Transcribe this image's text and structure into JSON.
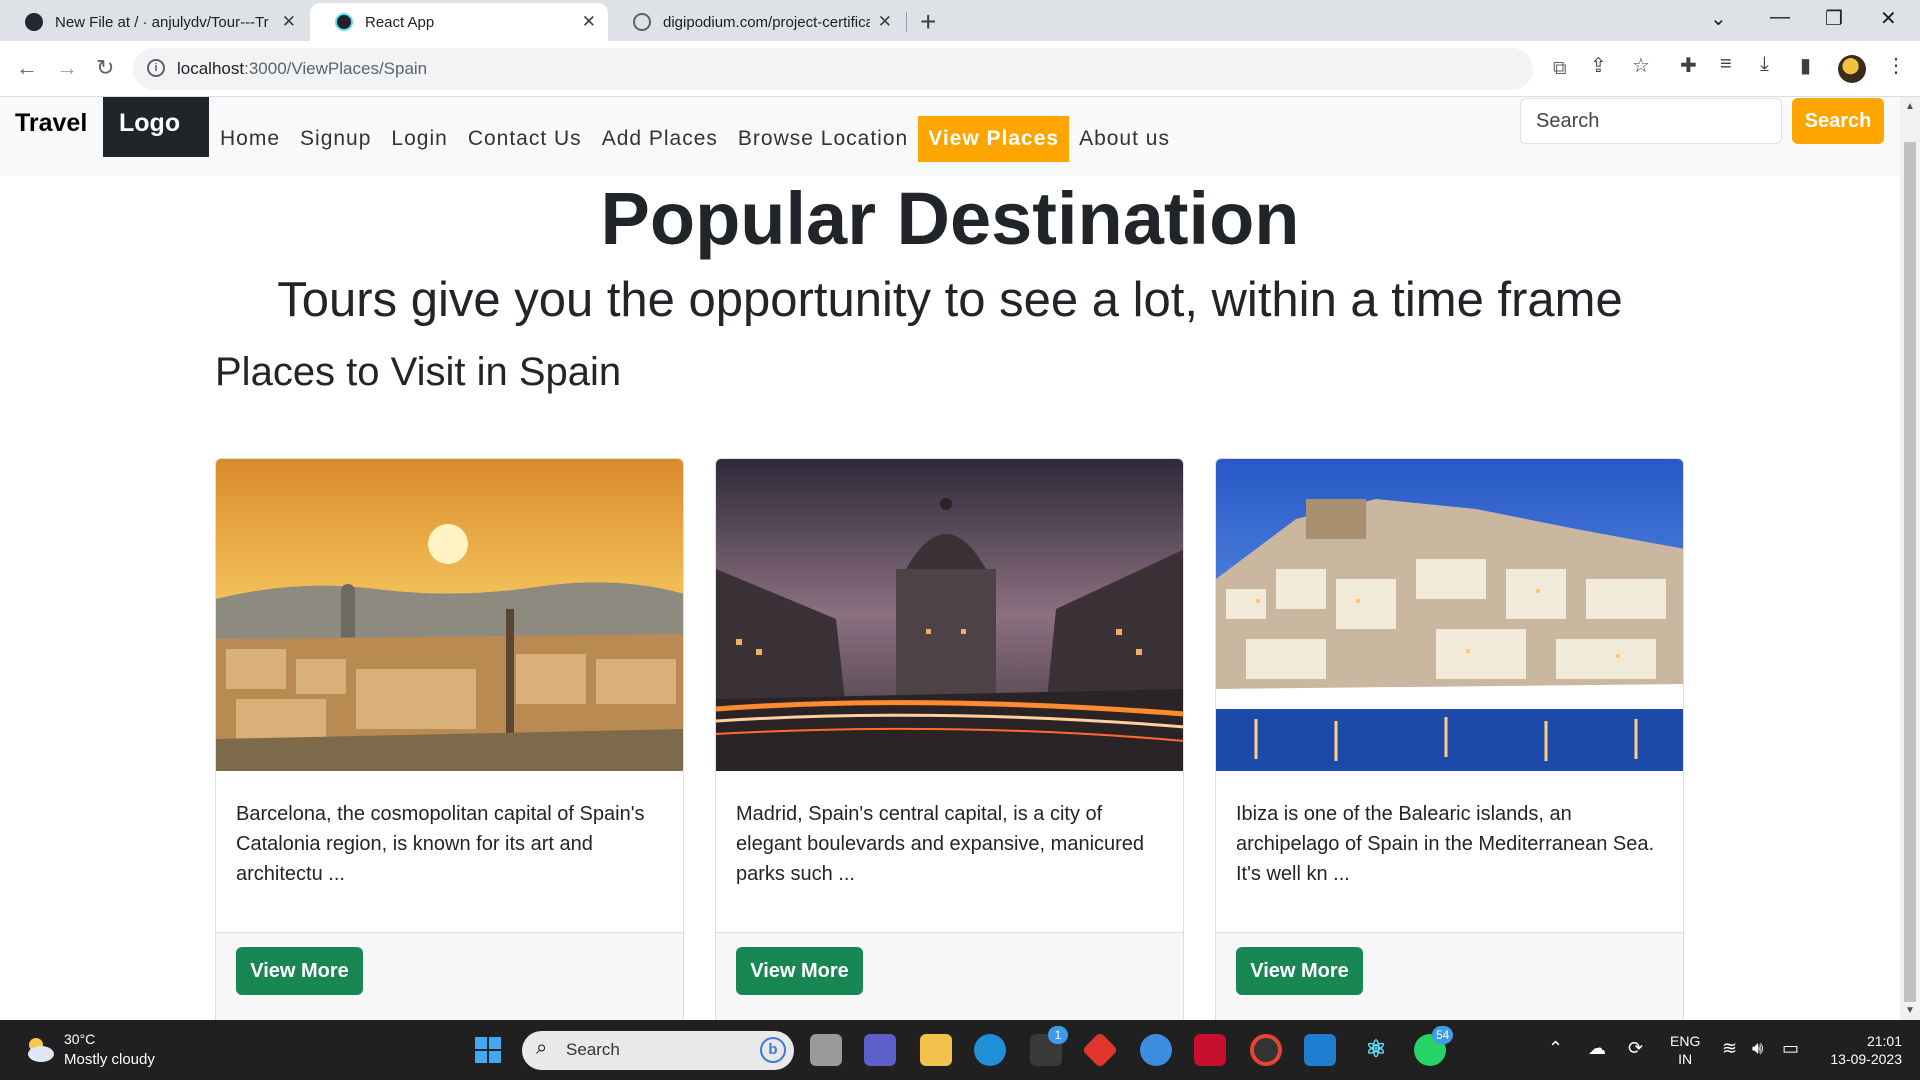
{
  "browser": {
    "tabs": [
      {
        "title": "New File at / · anjulydv/Tour---Tr",
        "active": false
      },
      {
        "title": "React App",
        "active": true
      },
      {
        "title": "digipodium.com/project-certifica",
        "active": false
      }
    ],
    "url_host": "localhost",
    "url_path": ":3000/ViewPlaces/Spain"
  },
  "navbar": {
    "brand": "Travel",
    "logo": "Logo",
    "links": [
      "Home",
      "Signup",
      "Login",
      "Contact Us",
      "Add Places",
      "Browse Location",
      "View Places",
      "About us"
    ],
    "active_link": "View Places",
    "search_placeholder": "Search",
    "search_button": "Search"
  },
  "page": {
    "title": "Popular Destination",
    "subtitle": "Tours give you the opportunity to see a lot, within a time frame",
    "section_heading": "Places to Visit in Spain"
  },
  "cards": [
    {
      "name": "Barcelona",
      "description": "Barcelona, the cosmopolitan capital of Spain's Catalonia region, is known for its art and architectu ...",
      "button": "View More"
    },
    {
      "name": "Madrid",
      "description": "Madrid, Spain's central capital, is a city of elegant boulevards and expansive, manicured parks such ...",
      "button": "View More"
    },
    {
      "name": "Ibiza",
      "description": "Ibiza is one of the Balearic islands, an archipelago of Spain in the Mediterranean Sea. It's well kn ...",
      "button": "View More"
    }
  ],
  "taskbar": {
    "temperature": "30°C",
    "weather": "Mostly cloudy",
    "search": "Search",
    "store_badge": "1",
    "whatsapp_badge": "54",
    "lang_top": "ENG",
    "lang_bottom": "IN",
    "time": "21:01",
    "date": "13-09-2023"
  },
  "colors": {
    "accent": "#ffa500",
    "button_green": "#198754",
    "logo_bg": "#212529",
    "navbar_bg": "#f8f9fa"
  }
}
